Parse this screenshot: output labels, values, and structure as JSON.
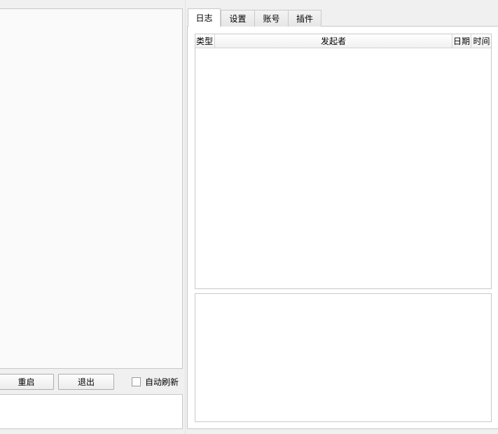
{
  "tabs": [
    {
      "label": "日志",
      "active": true
    },
    {
      "label": "设置",
      "active": false
    },
    {
      "label": "账号",
      "active": false
    },
    {
      "label": "插件",
      "active": false
    }
  ],
  "log_table": {
    "columns": [
      "类型",
      "发起者",
      "日期",
      "时间"
    ],
    "rows": []
  },
  "controls": {
    "restart_label": "重启",
    "exit_label": "退出",
    "auto_refresh_label": "自动刷新",
    "auto_refresh_checked": false
  }
}
